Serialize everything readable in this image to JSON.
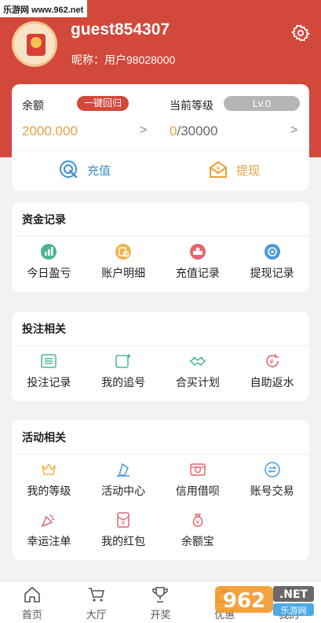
{
  "watermark": "乐游网 www.962.net",
  "user": {
    "name": "guest854307",
    "nickname": "昵称：用户98028000"
  },
  "balance": {
    "label": "余额",
    "badge": "一键回归",
    "value": "2000.000",
    "arrow": ">",
    "level_label": "当前等级",
    "level_badge": "Lv.0",
    "level_current": "0",
    "level_total": "/30000",
    "recharge": "充值",
    "withdraw": "提现"
  },
  "sections": [
    {
      "title": "资金记录",
      "items": [
        {
          "label": "今日盈亏",
          "icon": "chart-icon",
          "color": "#4cb58a"
        },
        {
          "label": "账户明细",
          "icon": "ledger-icon",
          "color": "#f0b34a"
        },
        {
          "label": "充值记录",
          "icon": "recharge-record-icon",
          "color": "#e5646d"
        },
        {
          "label": "提现记录",
          "icon": "withdraw-record-icon",
          "color": "#4a9ad9"
        }
      ]
    },
    {
      "title": "投注相关",
      "items": [
        {
          "label": "投注记录",
          "icon": "bet-record-icon",
          "color": "#4cb58a"
        },
        {
          "label": "我的追号",
          "icon": "chase-icon",
          "color": "#4cb58a"
        },
        {
          "label": "合买计划",
          "icon": "handshake-icon",
          "color": "#4cb58a"
        },
        {
          "label": "自助返水",
          "icon": "rebate-icon",
          "color": "#e5646d"
        }
      ]
    },
    {
      "title": "活动相关",
      "items": [
        {
          "label": "我的等级",
          "icon": "crown-icon",
          "color": "#f0b34a"
        },
        {
          "label": "活动中心",
          "icon": "activity-icon",
          "color": "#4a9ad9"
        },
        {
          "label": "信用借呗",
          "icon": "credit-icon",
          "color": "#e5646d"
        },
        {
          "label": "账号交易",
          "icon": "exchange-icon",
          "color": "#4a9ad9"
        },
        {
          "label": "幸运注单",
          "icon": "party-icon",
          "color": "#e5646d"
        },
        {
          "label": "我的红包",
          "icon": "redpacket-icon",
          "color": "#e5646d"
        },
        {
          "label": "余额宝",
          "icon": "moneybag-icon",
          "color": "#e5646d"
        }
      ]
    }
  ],
  "tabs": [
    {
      "label": "首页",
      "icon": "home-icon"
    },
    {
      "label": "大厅",
      "icon": "cart-icon"
    },
    {
      "label": "开奖",
      "icon": "trophy-icon"
    },
    {
      "label": "优惠",
      "icon": "gift-icon"
    },
    {
      "label": "我的",
      "icon": "user-icon"
    }
  ],
  "colors": {
    "brand": "#d2483a",
    "accent": "#e6a23c",
    "level_badge": "#b5b5b5"
  }
}
